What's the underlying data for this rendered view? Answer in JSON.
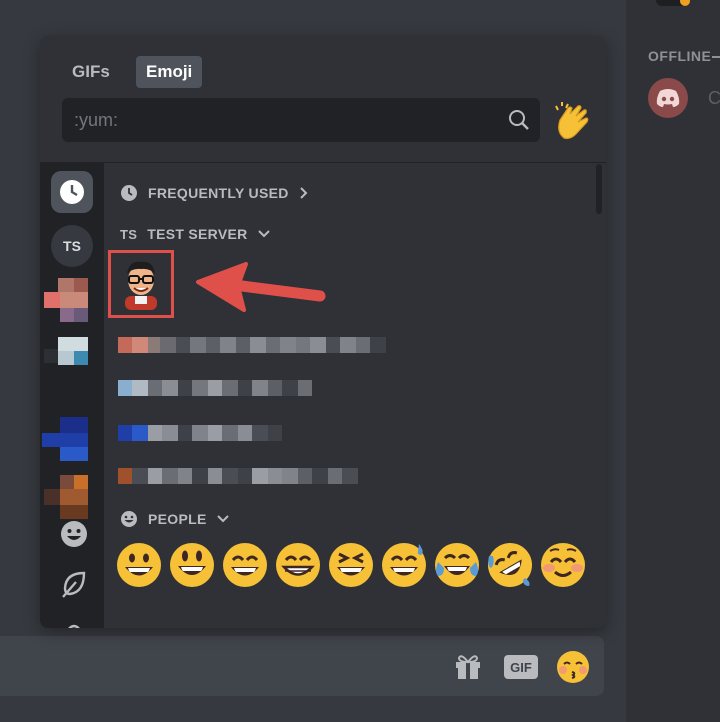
{
  "member_panel": {
    "section_label": "OFFLINE",
    "initial": "C"
  },
  "picker": {
    "tabs": [
      {
        "label": "GIFs",
        "active": false
      },
      {
        "label": "Emoji",
        "active": true
      }
    ],
    "search": {
      "placeholder": ":yum:"
    },
    "sections": {
      "frequently_used": "FREQUENTLY USED",
      "server_short": "TS",
      "server_name": "TEST SERVER",
      "people": "PEOPLE"
    },
    "sidebar": {
      "server_initials": "TS"
    }
  },
  "chat_bar": {
    "gif_label": "GIF"
  },
  "colors": {
    "background": "#36393f",
    "picker": "#2f3136",
    "sidebar": "#202225",
    "highlight": "#e0504a",
    "emoji_yellow": "#f7c137"
  }
}
